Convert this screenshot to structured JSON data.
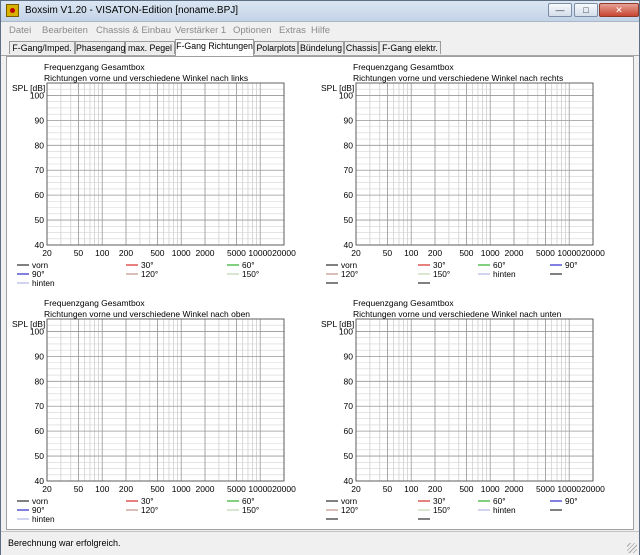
{
  "window": {
    "title": "Boxsim V1.20 - VISATON-Edition [noname.BPJ]"
  },
  "menu": [
    "Datei",
    "Bearbeiten",
    "Chassis & Einbau",
    "Verstärker 1",
    "Optionen",
    "Extras",
    "Hilfe"
  ],
  "tabs": [
    "F-Gang/Imped.",
    "Phasengang",
    "max. Pegel",
    "F-Gang Richtungen",
    "Polarplots",
    "Bündelung",
    "Chassis",
    "F-Gang elektr."
  ],
  "active_tab": "F-Gang Richtungen",
  "status": "Berechnung war erfolgreich.",
  "colors": {
    "vorn": "#000000",
    "30": "#d00000",
    "60": "#00a000",
    "90": "#0000c0",
    "120": "#b08070",
    "150": "#b0d0a0",
    "hinten": "#a0a8e0",
    "extra": "#000000"
  },
  "chart_data": [
    {
      "type": "line",
      "title": "Frequenzgang Gesamtbox",
      "subtitle": "Richtungen vorne und verschiedene Winkel nach links",
      "ylabel": "SPL [dB]",
      "x_ticks": [
        "20",
        "50",
        "100",
        "200",
        "500",
        "1000",
        "2000",
        "5000",
        "10000",
        "20000"
      ],
      "y_ticks": [
        "40",
        "50",
        "60",
        "70",
        "80",
        "90",
        "100"
      ],
      "xlim": [
        20,
        20000
      ],
      "ylim": [
        40,
        105
      ],
      "xscale": "log",
      "grid": true,
      "series": [
        {
          "name": "vorn",
          "values": []
        },
        {
          "name": "30°",
          "values": []
        },
        {
          "name": "60°",
          "values": []
        },
        {
          "name": "90°",
          "values": []
        },
        {
          "name": "120°",
          "values": []
        },
        {
          "name": "150°",
          "values": []
        },
        {
          "name": "hinten",
          "values": []
        }
      ]
    },
    {
      "type": "line",
      "title": "Frequenzgang Gesamtbox",
      "subtitle": "Richtungen vorne und verschiedene Winkel nach rechts",
      "ylabel": "SPL [dB]",
      "x_ticks": [
        "20",
        "50",
        "100",
        "200",
        "500",
        "1000",
        "2000",
        "5000",
        "10000",
        "20000"
      ],
      "y_ticks": [
        "40",
        "50",
        "60",
        "70",
        "80",
        "90",
        "100"
      ],
      "xlim": [
        20,
        20000
      ],
      "ylim": [
        40,
        105
      ],
      "xscale": "log",
      "grid": true,
      "series": [
        {
          "name": "vorn",
          "values": []
        },
        {
          "name": "30°",
          "values": []
        },
        {
          "name": "60°",
          "values": []
        },
        {
          "name": "90°",
          "values": []
        },
        {
          "name": "120°",
          "values": []
        },
        {
          "name": "150°",
          "values": []
        },
        {
          "name": "hinten",
          "values": []
        }
      ]
    },
    {
      "type": "line",
      "title": "Frequenzgang Gesamtbox",
      "subtitle": "Richtungen vorne und verschiedene Winkel nach oben",
      "ylabel": "SPL [dB]",
      "x_ticks": [
        "20",
        "50",
        "100",
        "200",
        "500",
        "1000",
        "2000",
        "5000",
        "10000",
        "20000"
      ],
      "y_ticks": [
        "40",
        "50",
        "60",
        "70",
        "80",
        "90",
        "100"
      ],
      "xlim": [
        20,
        20000
      ],
      "ylim": [
        40,
        105
      ],
      "xscale": "log",
      "grid": true,
      "series": [
        {
          "name": "vorn",
          "values": []
        },
        {
          "name": "30°",
          "values": []
        },
        {
          "name": "60°",
          "values": []
        },
        {
          "name": "90°",
          "values": []
        },
        {
          "name": "120°",
          "values": []
        },
        {
          "name": "150°",
          "values": []
        },
        {
          "name": "hinten",
          "values": []
        }
      ]
    },
    {
      "type": "line",
      "title": "Frequenzgang Gesamtbox",
      "subtitle": "Richtungen vorne und verschiedene Winkel nach unten",
      "ylabel": "SPL [dB]",
      "x_ticks": [
        "20",
        "50",
        "100",
        "200",
        "500",
        "1000",
        "2000",
        "5000",
        "10000",
        "20000"
      ],
      "y_ticks": [
        "40",
        "50",
        "60",
        "70",
        "80",
        "90",
        "100"
      ],
      "xlim": [
        20,
        20000
      ],
      "ylim": [
        40,
        105
      ],
      "xscale": "log",
      "grid": true,
      "series": [
        {
          "name": "vorn",
          "values": []
        },
        {
          "name": "30°",
          "values": []
        },
        {
          "name": "60°",
          "values": []
        },
        {
          "name": "90°",
          "values": []
        },
        {
          "name": "120°",
          "values": []
        },
        {
          "name": "150°",
          "values": []
        },
        {
          "name": "hinten",
          "values": []
        }
      ]
    }
  ]
}
